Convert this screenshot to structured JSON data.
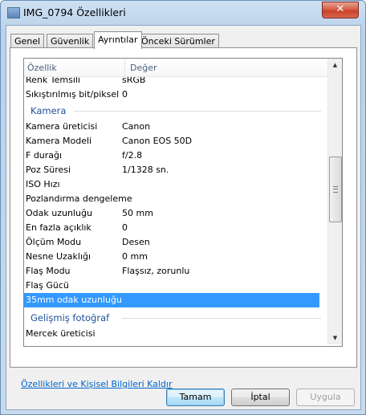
{
  "window": {
    "title": "IMG_0794 Özellikleri",
    "close_label": "✕"
  },
  "tabs": [
    {
      "label": "Genel"
    },
    {
      "label": "Güvenlik"
    },
    {
      "label": "Ayrıntılar",
      "active": true
    },
    {
      "label": "Önceki Sürümler"
    }
  ],
  "columns": {
    "property": "Özellik",
    "value": "Değer"
  },
  "rows_top": [
    {
      "label": "Renk Temsili",
      "value": "sRGB"
    },
    {
      "label": "Sıkıştırılmış bit/piksel",
      "value": "0"
    }
  ],
  "group_camera": "Kamera",
  "camera_rows": [
    {
      "label": "Kamera üreticisi",
      "value": "Canon"
    },
    {
      "label": "Kamera Modeli",
      "value": "Canon EOS 50D"
    },
    {
      "label": "F durağı",
      "value": "f/2.8"
    },
    {
      "label": "Poz Süresi",
      "value": "1/1328 sn."
    },
    {
      "label": "ISO Hızı",
      "value": ""
    },
    {
      "label": "Pozlandırma dengeleme",
      "value": ""
    },
    {
      "label": "Odak uzunluğu",
      "value": "50 mm"
    },
    {
      "label": "En fazla açıklık",
      "value": "0"
    },
    {
      "label": "Ölçüm Modu",
      "value": "Desen"
    },
    {
      "label": "Nesne Uzaklığı",
      "value": "0 mm"
    },
    {
      "label": "Flaş Modu",
      "value": "Flaşsız, zorunlu"
    },
    {
      "label": "Flaş Gücü",
      "value": ""
    },
    {
      "label": "35mm odak uzunluğu",
      "value": "",
      "selected": true
    }
  ],
  "group_advanced": "Gelişmiş fotoğraf",
  "partial_row": "Mercek üreticisi",
  "remove_link": "Özellikleri ve Kişisel Bilgileri Kaldır",
  "buttons": {
    "ok": "Tamam",
    "cancel": "İptal",
    "apply": "Uygula"
  },
  "colors": {
    "selection": "#3399ff",
    "group_text": "#1e4e9c",
    "link": "#0066cc"
  }
}
